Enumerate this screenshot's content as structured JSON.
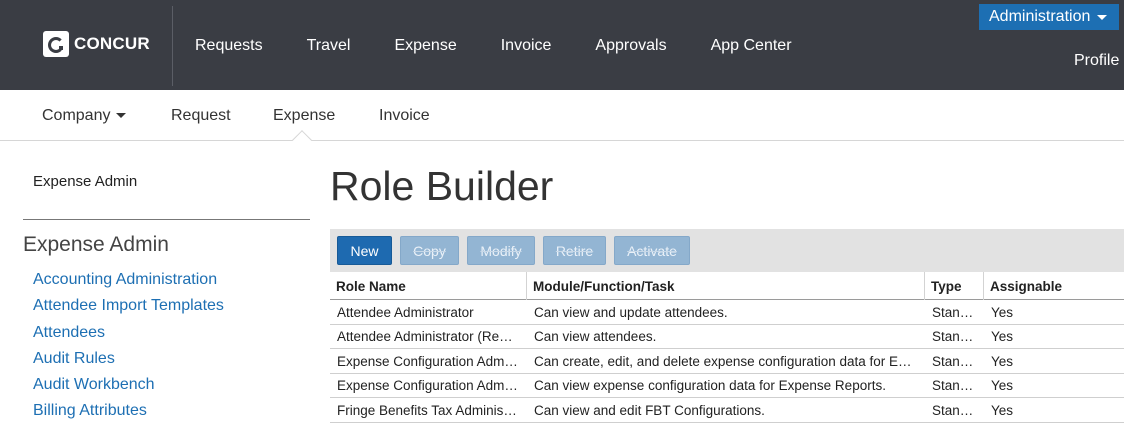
{
  "header": {
    "logo_text": "CONCUR",
    "nav": [
      "Requests",
      "Travel",
      "Expense",
      "Invoice",
      "Approvals",
      "App Center"
    ],
    "admin_label": "Administration",
    "profile_label": "Profile",
    "background": "#3a3d44",
    "accent": "#1d6fb3"
  },
  "subnav": {
    "items": [
      "Company",
      "Request",
      "Expense",
      "Invoice"
    ],
    "active": "Expense"
  },
  "sidebar": {
    "title": "Expense Admin",
    "heading": "Expense Admin",
    "links": [
      "Accounting Administration",
      "Attendee Import Templates",
      "Attendees",
      "Audit Rules",
      "Audit Workbench",
      "Billing Attributes"
    ]
  },
  "main": {
    "title": "Role Builder",
    "toolbar": {
      "new": "New",
      "copy": "Copy",
      "modify": "Modify",
      "retire": "Retire",
      "activate": "Activate"
    },
    "table": {
      "columns": [
        "Role Name",
        "Module/Function/Task",
        "Type",
        "Assignable"
      ],
      "rows": [
        {
          "name": "Attendee Administrator",
          "task": "Can view and update attendees.",
          "type": "Stan…",
          "assignable": "Yes"
        },
        {
          "name": "Attendee Administrator (Re…",
          "task": "Can view attendees.",
          "type": "Stan…",
          "assignable": "Yes"
        },
        {
          "name": "Expense Configuration Adm…",
          "task": "Can create, edit, and delete expense configuration data for E…",
          "type": "Stan…",
          "assignable": "Yes"
        },
        {
          "name": "Expense Configuration Adm…",
          "task": "Can view expense configuration data for Expense Reports.",
          "type": "Stan…",
          "assignable": "Yes"
        },
        {
          "name": "Fringe Benefits Tax Adminis…",
          "task": "Can view and edit FBT Configurations.",
          "type": "Stan…",
          "assignable": "Yes"
        }
      ]
    }
  }
}
